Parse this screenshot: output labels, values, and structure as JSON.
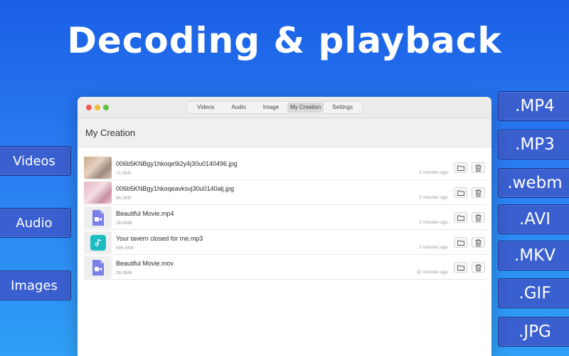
{
  "headline": "Decoding & playback",
  "left_labels": [
    "Videos",
    "Audio",
    "Images"
  ],
  "right_labels": [
    ".MP4",
    ".MP3",
    ".webm",
    ".AVI",
    ".MKV",
    ".GIF",
    ".JPG"
  ],
  "window": {
    "tabs": [
      "Videos",
      "Audio",
      "Image",
      "My Creation",
      "Settings"
    ],
    "active_tab": "My Creation",
    "section_title": "My Creation",
    "files": [
      {
        "name": "006b5KNBgy1hkoqe9i2y4j30u0140496.jpg",
        "size": "71.5KB",
        "time": "2 minutes ago",
        "thumb": "photo1"
      },
      {
        "name": "006b5KNBgy1hkoqeavksvj30u0140alj.jpg",
        "size": "86.3KB",
        "time": "2 minutes ago",
        "thumb": "photo2"
      },
      {
        "name": "Beautiful Movie.mp4",
        "size": "26.8MB",
        "time": "3 minutes ago",
        "thumb": "video"
      },
      {
        "name": "Your tavern closed for me.mp3",
        "size": "696.5KB",
        "time": "3 minutes ago",
        "thumb": "audio"
      },
      {
        "name": "Beautiful Movie.mov",
        "size": "26.9MB",
        "time": "32 minutes ago",
        "thumb": "video"
      }
    ]
  },
  "colors": {
    "background_top": "#1a5fe6",
    "background_bottom": "#2fa0f6",
    "label_bg": "#3a5fcf",
    "video_icon": "#7b7fe8",
    "audio_icon": "#1cbcc0"
  },
  "icons": {
    "row_actions": [
      "folder-icon",
      "trash-icon"
    ],
    "video_thumb": "video-file-icon",
    "audio_thumb": "audio-file-icon"
  }
}
